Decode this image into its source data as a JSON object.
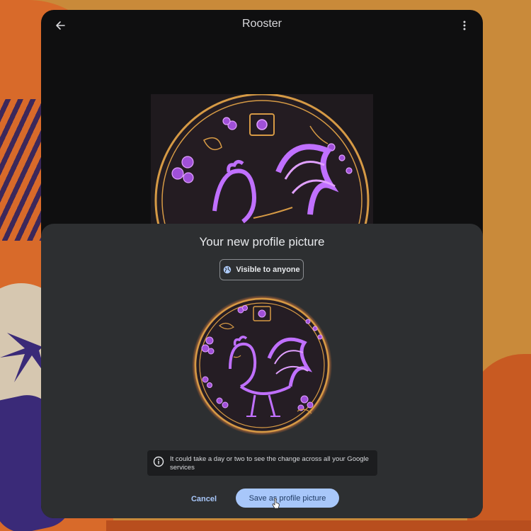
{
  "header": {
    "title": "Rooster",
    "back_icon": "arrow-back-icon",
    "more_icon": "more-vert-icon"
  },
  "sheet": {
    "title": "Your new profile picture",
    "visibility_label": "Visible to anyone",
    "visibility_icon": "globe-icon",
    "notice_icon": "info-icon",
    "notice_text": "It could take a day or two to see the change across all your Google services",
    "cancel_label": "Cancel",
    "save_label": "Save as profile picture"
  },
  "colors": {
    "accent": "#a8c7fa",
    "sheet_bg": "#2d2f31",
    "window_bg": "#0f0f10",
    "rooster_purple": "#c070ff",
    "ring_gold": "#d69a45"
  }
}
